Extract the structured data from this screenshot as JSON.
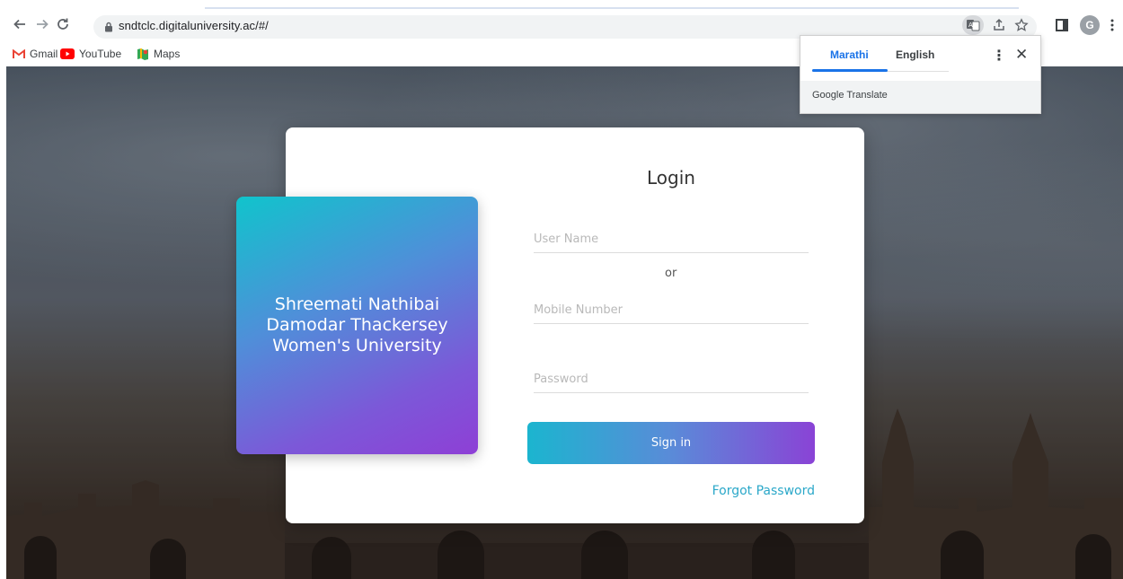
{
  "browser": {
    "url": "sndtclc.digitaluniversity.ac/#/",
    "avatar_initial": "G",
    "bookmarks": [
      {
        "label": "Gmail",
        "icon": "gmail-icon"
      },
      {
        "label": "YouTube",
        "icon": "youtube-icon"
      },
      {
        "label": "Maps",
        "icon": "maps-icon"
      }
    ]
  },
  "translate_popup": {
    "tab_source": "Marathi",
    "tab_target": "English",
    "brand": "Google Translate"
  },
  "login": {
    "title": "Login",
    "university_name": "Shreemati Nathibai Damodar Thackersey Women's University",
    "username_placeholder": "User Name",
    "or_text": "or",
    "mobile_placeholder": "Mobile Number",
    "password_placeholder": "Password",
    "signin_label": "Sign in",
    "forgot_label": "Forgot Password"
  },
  "colors": {
    "accent_cyan": "#10c4cc",
    "accent_purple": "#8e3fd6",
    "link": "#2ba8c9",
    "translate_blue": "#1a73e8"
  }
}
